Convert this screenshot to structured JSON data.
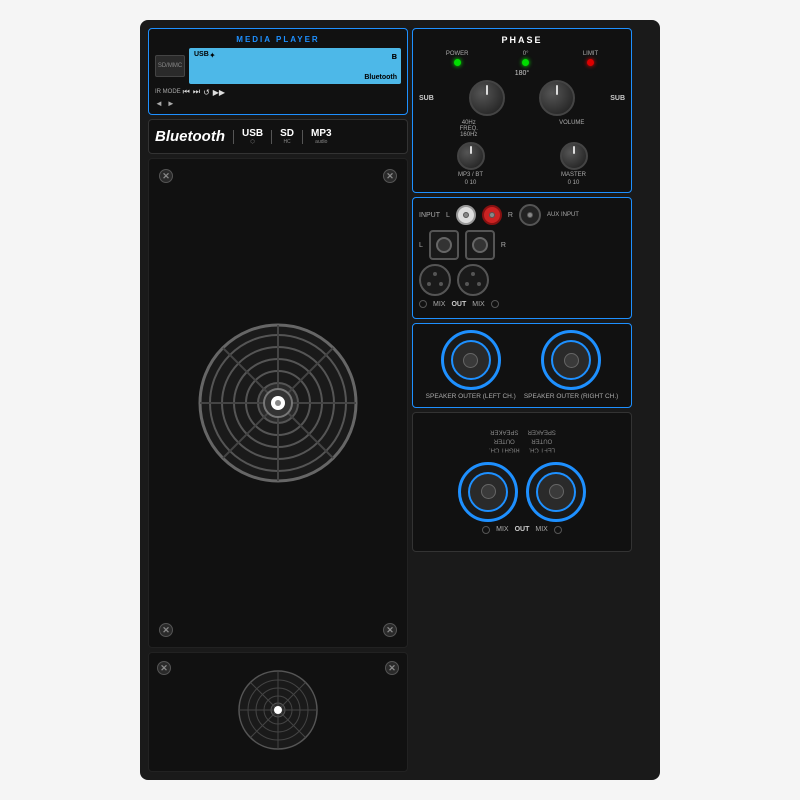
{
  "header": {
    "media_player_title": "MEDIA PLAYER",
    "phase_title": "PHASE"
  },
  "media_player": {
    "usb_label": "USB",
    "bluetooth_label": "Bluetooth",
    "ir_mode": "IR MODE",
    "controls": [
      "⏮",
      "⏭",
      "↺",
      "⏭⏭"
    ],
    "vol_symbols": [
      "◄",
      "►"
    ]
  },
  "features": {
    "bluetooth": "Bluetooth",
    "usb": "USB",
    "sd": "SD",
    "mp3": "MP3"
  },
  "phase": {
    "power_label": "POWER",
    "zero_label": "0°",
    "limit_label": "LIMIT",
    "sub_left": "SUB",
    "sub_right": "SUB",
    "freq_40": "40Hz",
    "freq_160": "160Hz",
    "freq_label": "FREQ.",
    "volume_label": "VOLUME",
    "mp3_bt_label": "MP3 / BT",
    "master_label": "MASTER",
    "phase_180": "180°",
    "range_0_10": "0         10",
    "range_0_10b": "0         10"
  },
  "inputs": {
    "input_label": "INPUT",
    "l_label": "L",
    "r_label": "R",
    "aux_label": "AUX INPUT",
    "mix_label": "MIX",
    "out_label": "OUT"
  },
  "speakers": {
    "left_label": "SPEAKER\nOUTER\n(LEFT CH.)",
    "right_label": "SPEAKER\nOUTER\n(RIGHT CH.)"
  },
  "colors": {
    "accent": "#1e90ff",
    "background": "#1a1a1a",
    "panel": "#111111",
    "led_green": "#00dd00",
    "led_red": "#dd0000"
  }
}
